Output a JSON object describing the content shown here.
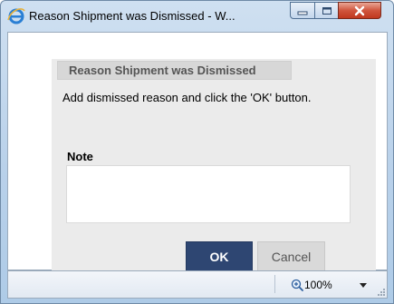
{
  "window": {
    "title": "Reason Shipment was Dismissed - W..."
  },
  "dialog": {
    "tab_title": "Reason Shipment was Dismissed",
    "instructions": "Add dismissed reason and click the 'OK' button.",
    "note_label": "Note",
    "note_value": "",
    "ok_label": "OK",
    "cancel_label": "Cancel"
  },
  "statusbar": {
    "zoom": "100%"
  },
  "icons": {
    "browser": "internet-explorer-icon",
    "minimize": "minimize-icon",
    "maximize": "maximize-icon",
    "close": "close-icon",
    "zoom": "zoom-icon",
    "dropdown": "chevron-down-icon"
  },
  "colors": {
    "ok_button": "#2e4672",
    "close_button": "#c0381e"
  }
}
